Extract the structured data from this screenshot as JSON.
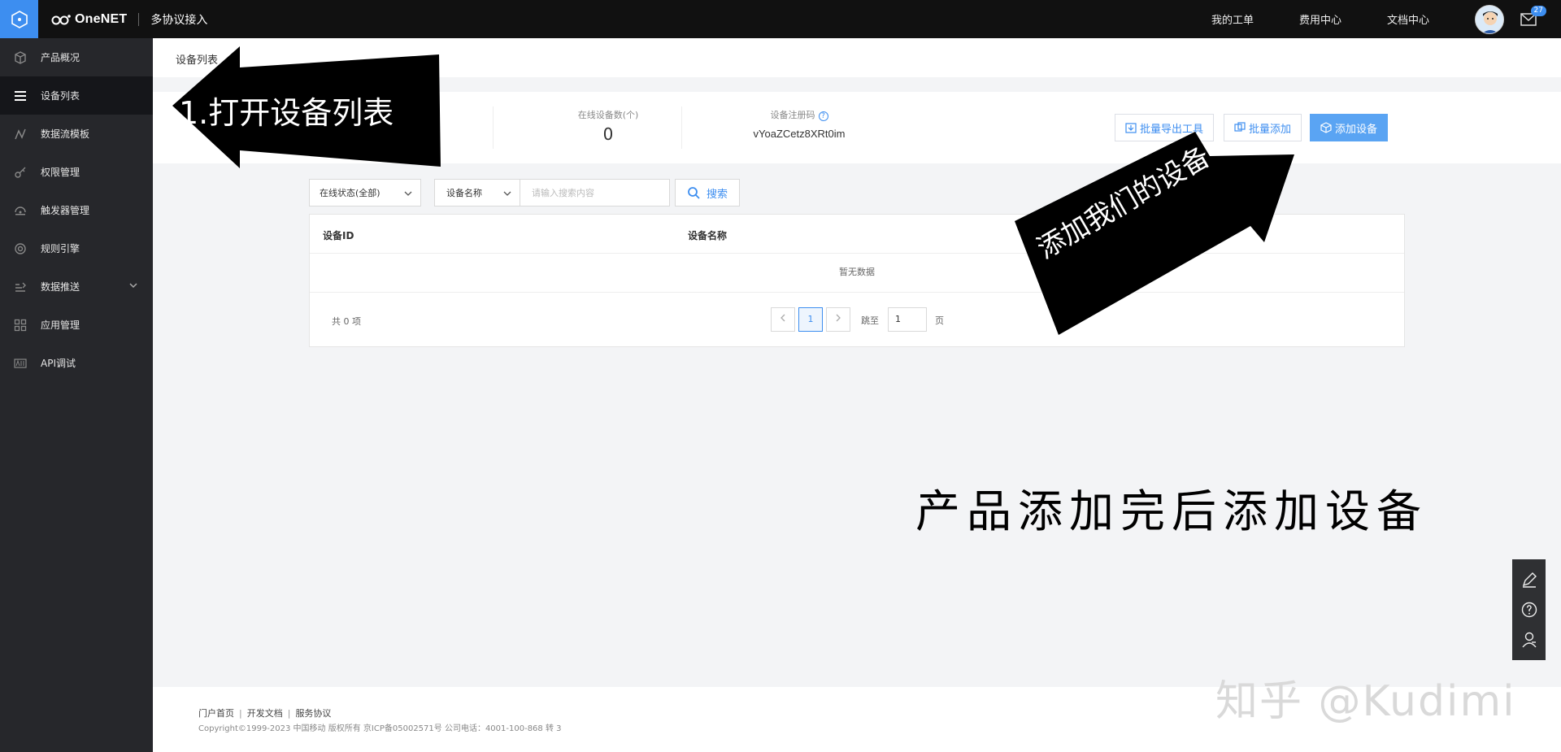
{
  "topbar": {
    "brand": "OneNET",
    "product": "多协议接入",
    "links": [
      "我的工单",
      "费用中心",
      "文档中心"
    ],
    "mail_badge": "27"
  },
  "sidebar": {
    "items": [
      {
        "label": "产品概况",
        "icon": "cube-icon"
      },
      {
        "label": "设备列表",
        "icon": "list-icon"
      },
      {
        "label": "数据流模板",
        "icon": "stream-icon"
      },
      {
        "label": "权限管理",
        "icon": "key-icon"
      },
      {
        "label": "触发器管理",
        "icon": "trigger-icon"
      },
      {
        "label": "规则引擎",
        "icon": "rule-icon"
      },
      {
        "label": "数据推送",
        "icon": "push-icon"
      },
      {
        "label": "应用管理",
        "icon": "apps-icon"
      },
      {
        "label": "API调试",
        "icon": "api-icon"
      }
    ]
  },
  "breadcrumb": "设备列表",
  "stats": {
    "online_label": "在线设备数(个)",
    "online_value": "0",
    "code_label": "设备注册码",
    "code_value": "vYoaZCetz8XRt0im"
  },
  "actions": {
    "export": "批量导出工具",
    "batch_add": "批量添加",
    "add": "添加设备"
  },
  "filters": {
    "status": "在线状态(全部)",
    "field": "设备名称",
    "placeholder": "请输入搜索内容",
    "search": "搜索"
  },
  "table": {
    "headers": [
      "设备ID",
      "设备名称"
    ],
    "empty": "暂无数据",
    "total": "共 0 项",
    "page": "1",
    "jump_label": "跳至",
    "jump_value": "1",
    "page_unit": "页"
  },
  "annotations": {
    "step1": "1.打开设备列表",
    "add_hint": "添加我们的设备",
    "caption": "产品添加完后添加设备"
  },
  "footer": {
    "links": [
      "门户首页",
      "开发文档",
      "服务协议"
    ],
    "copyright": "Copyright©1999-2023 中国移动 版权所有 京ICP备05002571号 公司电话：4001-100-868 转 3"
  },
  "watermark": "知乎 @Kudimi"
}
